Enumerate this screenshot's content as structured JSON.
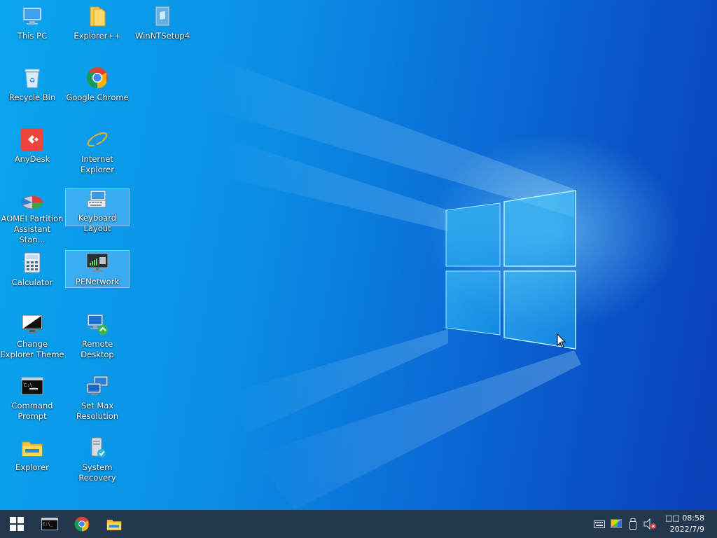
{
  "desktop": {
    "icons": [
      {
        "label": "This PC",
        "icon": "this-pc-icon"
      },
      {
        "label": "Explorer++",
        "icon": "folder-icon"
      },
      {
        "label": "WinNTSetup4",
        "icon": "winntsetup-icon"
      },
      {
        "label": "Recycle Bin",
        "icon": "recycle-bin-icon"
      },
      {
        "label": "Google Chrome",
        "icon": "chrome-icon"
      },
      {
        "label": "AnyDesk",
        "icon": "anydesk-icon"
      },
      {
        "label": "Internet Explorer",
        "icon": "internet-explorer-icon"
      },
      {
        "label": "AOMEI Partition Assistant Stan...",
        "icon": "aomei-icon"
      },
      {
        "label": "Keyboard Layout",
        "icon": "keyboard-icon"
      },
      {
        "label": "Calculator",
        "icon": "calculator-icon"
      },
      {
        "label": "PENetwork",
        "icon": "network-icon"
      },
      {
        "label": "Change Explorer Theme",
        "icon": "theme-icon"
      },
      {
        "label": "Remote Desktop",
        "icon": "remote-desktop-icon"
      },
      {
        "label": "Command Prompt",
        "icon": "cmd-icon"
      },
      {
        "label": "Set Max Resolution",
        "icon": "resolution-icon"
      },
      {
        "label": "Explorer",
        "icon": "explorer-icon"
      },
      {
        "label": "System Recovery",
        "icon": "recovery-icon"
      }
    ]
  },
  "taskbar": {
    "pinned": [
      "start-icon",
      "cmd-icon",
      "chrome-icon",
      "explorer-icon"
    ],
    "tray": [
      "keyboard-icon",
      "color-icon",
      "usb-icon",
      "volume-muted-icon"
    ],
    "clock": {
      "time": "□□ 08:58",
      "date": "2022/7/9"
    }
  },
  "colors": {
    "taskbar": "#23374d",
    "accent": "#0a8fe6"
  }
}
